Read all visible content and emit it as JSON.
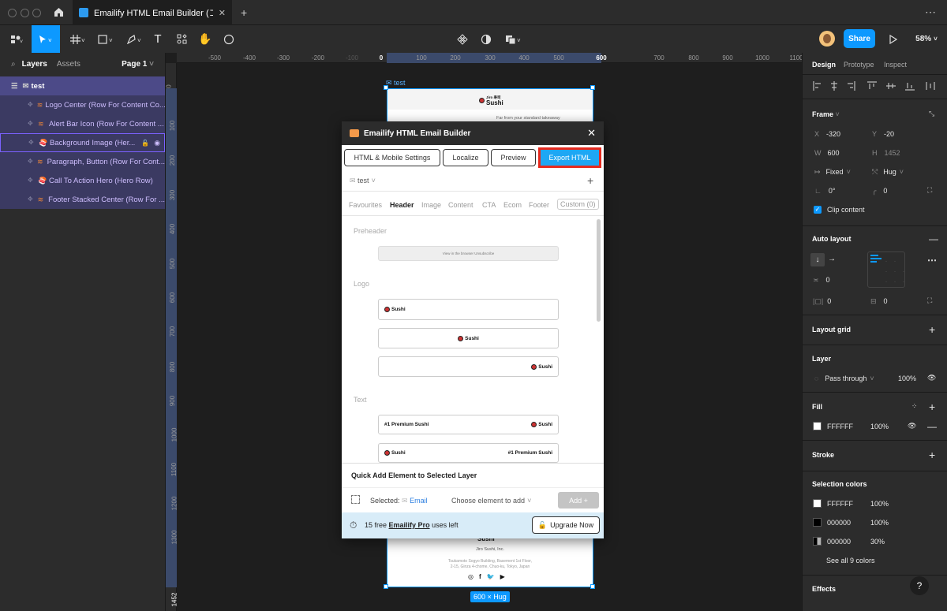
{
  "titlebar": {
    "tab_title": "Emailify HTML Email Builder (コミュニテ",
    "plus": "+",
    "more": "⋯"
  },
  "toolbar": {
    "share_label": "Share",
    "zoom": "58%"
  },
  "left_panel": {
    "tab_layers": "Layers",
    "tab_assets": "Assets",
    "page": "Page 1",
    "root_layer": "test",
    "layers": [
      {
        "label": "Logo Center (Row For Content Co..."
      },
      {
        "label": "Alert Bar Icon (Row For Content ..."
      },
      {
        "label": "Background Image (Her..."
      },
      {
        "label": "Paragraph, Button (Row For Cont..."
      },
      {
        "label": "Call To Action Hero (Hero Row)"
      },
      {
        "label": "Footer Stacked Center (Row For ..."
      }
    ]
  },
  "ruler_top": [
    "-500",
    "-400",
    "-300",
    "-200",
    "-100",
    "0",
    "100",
    "200",
    "300",
    "400",
    "500",
    "600",
    "700",
    "800",
    "900",
    "1000",
    "1100",
    "120"
  ],
  "ruler_left": [
    "0",
    "100",
    "200",
    "300",
    "400",
    "500",
    "600",
    "700",
    "800",
    "900",
    "1000",
    "1100",
    "1200",
    "1300",
    "1452"
  ],
  "canvas": {
    "frame_label": "test",
    "size_badge": "600 × Hug",
    "email_brand_small": "Jiro 寿司",
    "email_brand": "Sushi",
    "email_tagline": "Far from your standard takeaway",
    "footer_company": "Jiro Sushi, Inc.",
    "footer_address1": "Tsukamoto Sogyo Building, Basement 1st Floor,",
    "footer_address2": "2-15, Ginza 4-chome, Chuo-ku, Tokyo, Japan"
  },
  "plugin": {
    "title": "Emailify HTML Email Builder",
    "buttons": {
      "settings": "HTML & Mobile Settings",
      "localize": "Localize",
      "preview": "Preview",
      "export": "Export HTML"
    },
    "email_select": "test",
    "categories": [
      "Favourites",
      "Header",
      "Image",
      "Content",
      "CTA",
      "Ecom",
      "Footer",
      "Custom (0)"
    ],
    "active_category": "Header",
    "sections": {
      "preheader": "Preheader",
      "logo": "Logo",
      "text": "Text"
    },
    "preheader_links": "View in the browser  Unsubscribe",
    "text_row_1": "#1 Premium Sushi",
    "text_row_2": "#1 Premium Sushi",
    "quick_add_title": "Quick Add Element to Selected Layer",
    "selected_label": "Selected:",
    "selected_value": "Email",
    "choose_placeholder": "Choose element to add",
    "add_button": "Add +",
    "free_prefix": "15 free",
    "free_pro": "Emailify Pro",
    "free_suffix": "uses left",
    "upgrade": "Upgrade Now"
  },
  "right_panel": {
    "tabs": [
      "Design",
      "Prototype",
      "Inspect"
    ],
    "frame_title": "Frame",
    "x_label": "X",
    "x_value": "-320",
    "y_label": "Y",
    "y_value": "-20",
    "w_label": "W",
    "w_value": "600",
    "h_label": "H",
    "h_value": "1452",
    "width_mode": "Fixed",
    "height_mode": "Hug",
    "rotation": "0°",
    "radius": "0",
    "clip_content": "Clip content",
    "auto_layout": "Auto layout",
    "spacing": "0",
    "pad_h": "0",
    "pad_v": "0",
    "layout_grid": "Layout grid",
    "layer_title": "Layer",
    "blend": "Pass through",
    "layer_opacity": "100%",
    "fill_title": "Fill",
    "fill_hex": "FFFFFF",
    "fill_opacity": "100%",
    "stroke_title": "Stroke",
    "selection_colors_title": "Selection colors",
    "selection_colors": [
      {
        "hex": "FFFFFF",
        "opacity": "100%",
        "color": "#ffffff"
      },
      {
        "hex": "000000",
        "opacity": "100%",
        "color": "#000000"
      },
      {
        "hex": "000000",
        "opacity": "30%",
        "color": "#b3b3b3"
      }
    ],
    "see_all": "See all 9 colors",
    "effects": "Effects",
    "help": "?"
  },
  "colors": {
    "accent": "#0d99ff",
    "export_border": "#e52a1e",
    "export_fill": "#1ea7f4",
    "layer_selected": "#3b3a62"
  }
}
